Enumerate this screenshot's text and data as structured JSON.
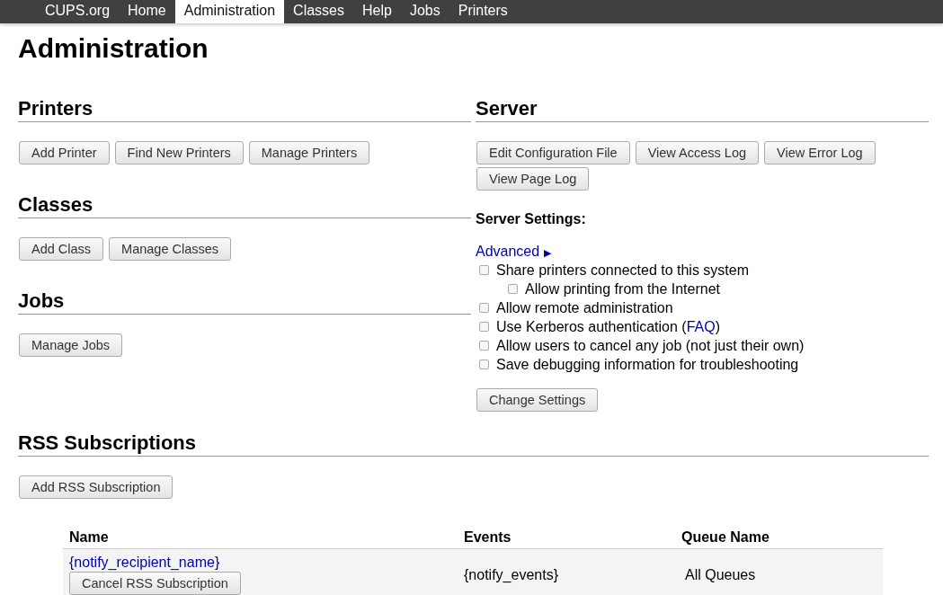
{
  "nav": [
    {
      "label": "CUPS.org",
      "selected": false
    },
    {
      "label": "Home",
      "selected": false
    },
    {
      "label": "Administration",
      "selected": true
    },
    {
      "label": "Classes",
      "selected": false
    },
    {
      "label": "Help",
      "selected": false
    },
    {
      "label": "Jobs",
      "selected": false
    },
    {
      "label": "Printers",
      "selected": false
    }
  ],
  "page_title": "Administration",
  "left_sections": [
    {
      "heading": "Printers",
      "buttons": [
        "Add Printer",
        "Find New Printers",
        "Manage Printers"
      ]
    },
    {
      "heading": "Classes",
      "buttons": [
        "Add Class",
        "Manage Classes"
      ]
    },
    {
      "heading": "Jobs",
      "buttons": [
        "Manage Jobs"
      ]
    }
  ],
  "server": {
    "heading": "Server",
    "buttons": [
      "Edit Configuration File",
      "View Access Log",
      "View Error Log",
      "View Page Log"
    ],
    "settings_heading": "Server Settings:",
    "advanced_link": "Advanced",
    "advanced_arrow": "▶",
    "options": [
      {
        "label": "Share printers connected to this system",
        "checked": false,
        "children": [
          {
            "label": "Allow printing from the Internet",
            "checked": false
          }
        ]
      },
      {
        "label": "Allow remote administration",
        "checked": false
      },
      {
        "label": "Use Kerberos authentication (",
        "link": "FAQ",
        "label_end": ")",
        "checked": false
      },
      {
        "label": "Allow users to cancel any job (not just their own)",
        "checked": false
      },
      {
        "label": "Save debugging information for troubleshooting",
        "checked": false
      }
    ],
    "submit": "Change Settings"
  },
  "rss": {
    "heading": "RSS Subscriptions",
    "button": "Add RSS Subscription",
    "columns": [
      "Name",
      "Events",
      "Queue Name"
    ],
    "rows": [
      {
        "name": "{notify_recipient_name}",
        "cancel_button": "Cancel RSS Subscription",
        "events": "{notify_events}",
        "queue": "All Queues"
      }
    ]
  }
}
